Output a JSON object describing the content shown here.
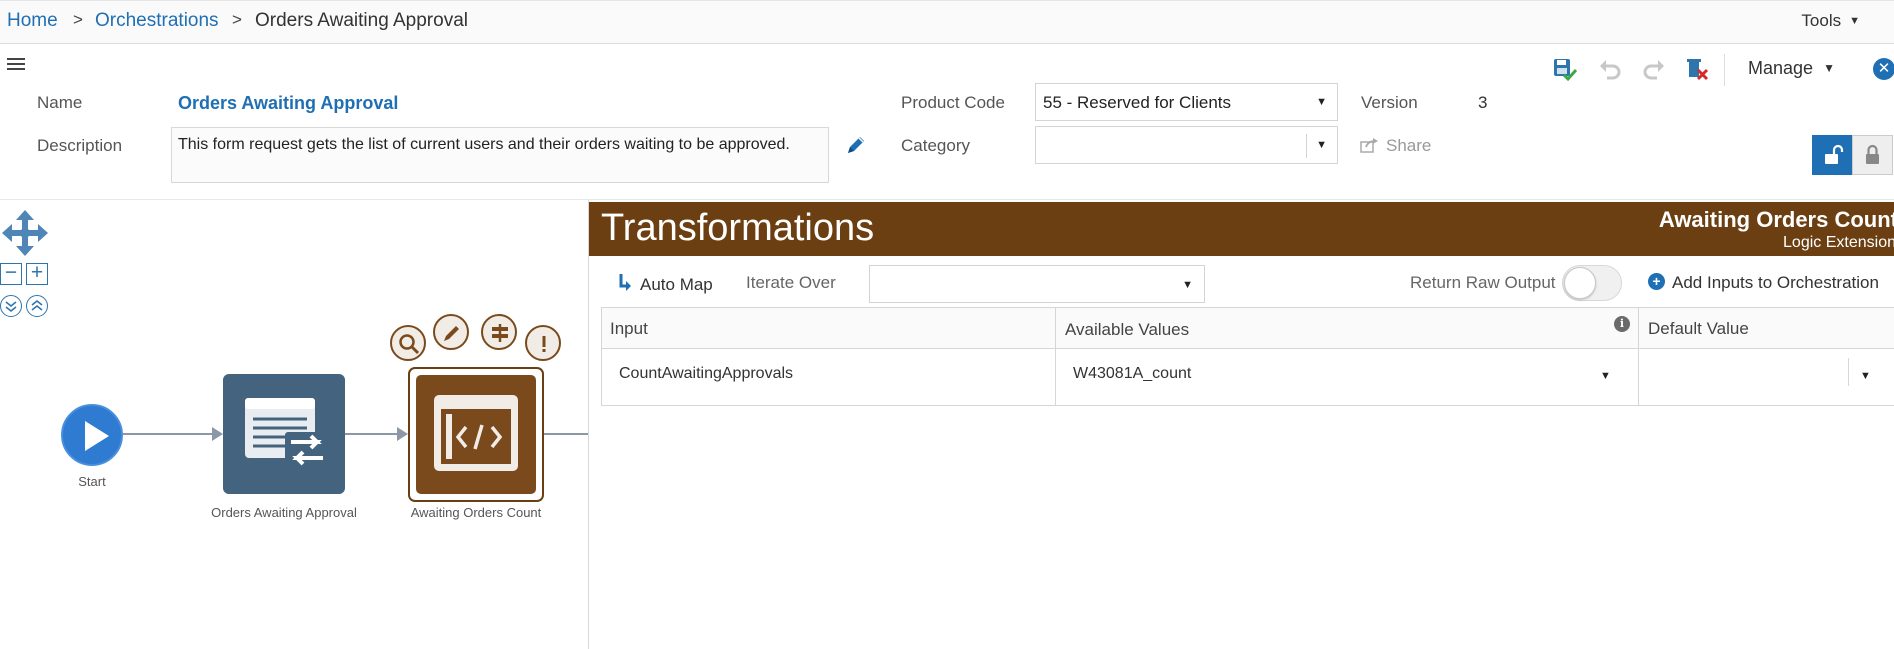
{
  "breadcrumb": {
    "items": [
      "Home",
      "Orchestrations",
      "Orders Awaiting Approval"
    ],
    "separator": ">"
  },
  "tools_menu": {
    "label": "Tools"
  },
  "toolbar": {
    "manage_label": "Manage",
    "icons": [
      "save-icon",
      "undo-icon",
      "redo-icon",
      "delete-icon",
      "close-icon"
    ]
  },
  "form": {
    "name_label": "Name",
    "name_value": "Orders Awaiting Approval",
    "description_label": "Description",
    "description_value": "This form request gets the list of current users and their orders waiting to be approved.",
    "product_code_label": "Product Code",
    "product_code_value": "55 - Reserved for Clients",
    "category_label": "Category",
    "category_value": "",
    "version_label": "Version",
    "version_value": "3",
    "share_label": "Share"
  },
  "canvas": {
    "nodes": [
      {
        "label": "Start",
        "type": "start"
      },
      {
        "label": "Orders Awaiting Approval",
        "type": "form-request"
      },
      {
        "label": "Awaiting Orders Count",
        "type": "logic-extension"
      }
    ],
    "node_actions": [
      "search-icon",
      "edit-icon",
      "transform-icon",
      "alert-icon"
    ]
  },
  "transformations": {
    "title": "Transformations",
    "component_name": "Awaiting Orders Count",
    "component_type": "Logic Extension",
    "auto_map_label": "Auto Map",
    "iterate_over_label": "Iterate Over",
    "iterate_over_value": "",
    "return_raw_output_label": "Return Raw Output",
    "return_raw_output": false,
    "add_inputs_label": "Add Inputs to Orchestration",
    "columns": [
      "Input",
      "Available Values",
      "Default Value"
    ],
    "rows": [
      {
        "input": "CountAwaitingApprovals",
        "available_value": "W43081A_count",
        "default_value": ""
      }
    ]
  },
  "colors": {
    "link_blue": "#1f6fb4",
    "transform_header_brown": "#6b3f12",
    "form_node_slate": "#44637f",
    "logic_node_brown": "#7a4a1c",
    "start_node_blue": "#2f7bd1"
  }
}
